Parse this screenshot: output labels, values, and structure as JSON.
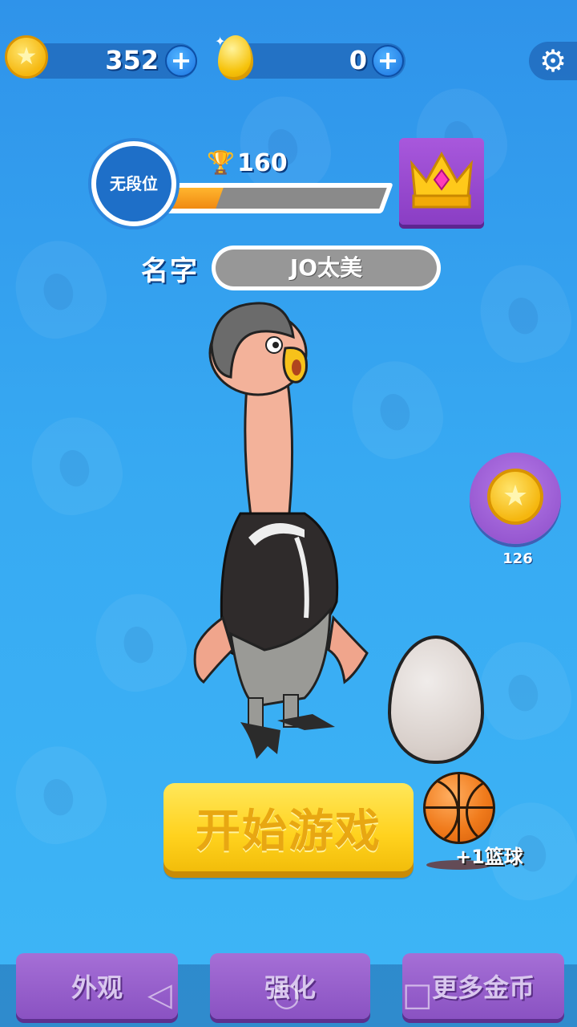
{
  "resources": {
    "coins": {
      "icon": "star-coin-icon",
      "value": "352"
    },
    "eggs": {
      "icon": "golden-egg-icon",
      "value": "0"
    },
    "add_symbol": "+"
  },
  "settings": {
    "icon": "gear-icon"
  },
  "rank": {
    "label": "无段位",
    "trophy_icon": "trophy-icon",
    "trophies": "160",
    "progress": 0.25
  },
  "crown_button": {
    "icon": "crown-icon"
  },
  "player": {
    "name_label": "名字",
    "name": "JO太美"
  },
  "side_reward": {
    "icon": "star-coin-icon",
    "count": "126"
  },
  "start_button": {
    "label": "开始游戏"
  },
  "bonus": {
    "icon": "basketball-icon",
    "label": "+1篮球"
  },
  "bottom_nav": [
    {
      "label": "外观"
    },
    {
      "label": "强化"
    },
    {
      "label": "更多金币"
    }
  ],
  "system_nav": {
    "back_icon": "◁",
    "home_icon": "○",
    "recents_icon": "□"
  },
  "colors": {
    "background": "#37a9f2",
    "accent_yellow": "#ffd21e",
    "purple": "#8a52c2",
    "progress_orange": "#f08a12"
  }
}
